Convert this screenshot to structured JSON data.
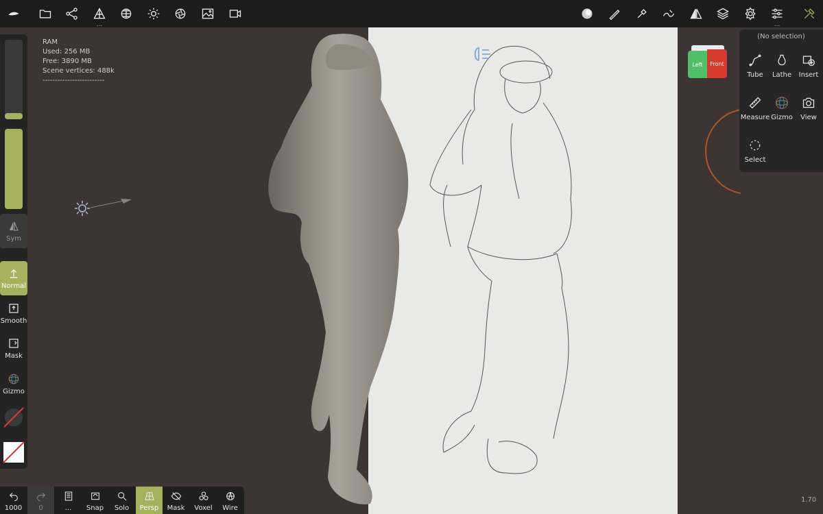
{
  "hud": {
    "ram": "RAM",
    "used": "Used: 256 MB",
    "free": "Free: 3890 MB",
    "vertices": "Scene vertices: 488k",
    "separator": "-------------------------"
  },
  "topbar": {
    "icons": [
      "logo-icon",
      "folder-icon",
      "scene-graph-icon",
      "mesh-icon",
      "sphere-grid-icon",
      "sun-icon",
      "aperture-icon",
      "image-icon",
      "camera-icon",
      "material-sphere-icon",
      "brush-icon",
      "paint-icon",
      "stroke-icon",
      "symmetry-icon",
      "layers-icon",
      "settings-icon",
      "sliders-icon",
      "tools-icon"
    ],
    "more": "..."
  },
  "leftpanel": {
    "sym_label": "Sym",
    "normal_label": "Normal",
    "smooth_label": "Smooth",
    "mask_label": "Mask",
    "gizmo_label": "Gizmo",
    "accent": "#a6b15c"
  },
  "bottombar": {
    "undo_count": "1000",
    "redo_count": "0",
    "history_label": "...",
    "snap_label": "Snap",
    "solo_label": "Solo",
    "persp_label": "Persp",
    "mask_label": "Mask",
    "voxel_label": "Voxel",
    "wire_label": "Wire"
  },
  "rpanel": {
    "title": "(No selection)",
    "tube_label": "Tube",
    "lathe_label": "Lathe",
    "insert_label": "Insert",
    "measure_label": "Measure",
    "gizmo_label": "Gizmo",
    "view_label": "View",
    "select_label": "Select"
  },
  "navcube": {
    "left_label": "Left",
    "front_label": "Front"
  },
  "zoom_level": "1.70"
}
